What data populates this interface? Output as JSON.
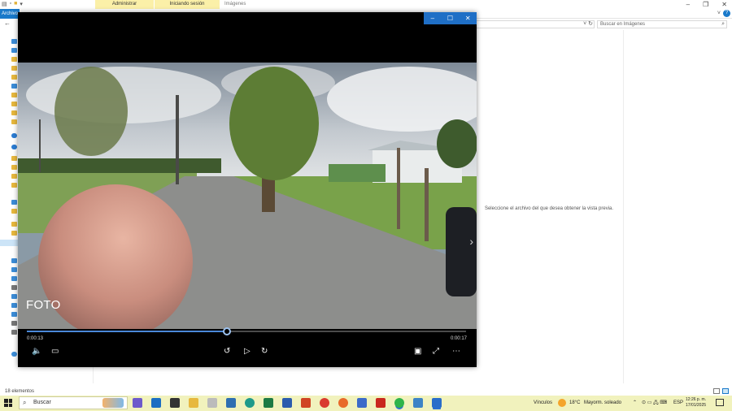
{
  "explorer": {
    "tab_archivo": "Archivo",
    "ctx_admin": "Administrar",
    "ctx_login": "Iniciando sesión",
    "window_title": "Imágenes",
    "search_placeholder": "Buscar en Imágenes",
    "preview_message": "Seleccione el archivo del que desea obtener la vista previa.",
    "status_count": "18 elementos"
  },
  "player": {
    "caption": "FOTO",
    "time_current": "0:00:13",
    "time_total": "0:00:17",
    "progress": 0.455,
    "buttons": {
      "minimize": "–",
      "maximize": "☐",
      "close": "✕"
    }
  },
  "taskbar": {
    "search_label": "Buscar",
    "links_label": "Vínculos",
    "temperature": "18°C",
    "weather": "Mayorm. soleado",
    "language": "ESP",
    "time": "12:26 p. m.",
    "date": "17/01/2025"
  },
  "colors": {
    "accent": "#1f6fc6",
    "context_tab": "#fbf0a8",
    "taskbar": "#f1f2bd",
    "timeline_fill": "#4a88d8"
  }
}
